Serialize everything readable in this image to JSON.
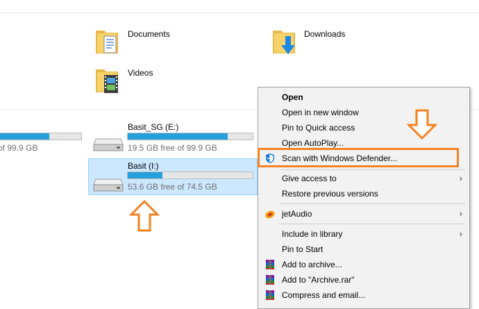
{
  "folders": [
    {
      "name": "Documents"
    },
    {
      "name": "Downloads"
    },
    {
      "name": "Videos"
    }
  ],
  "drives": [
    {
      "name": "",
      "free_text": "of 99.9 GB",
      "used_fraction": 0.62
    },
    {
      "name": "Basit_SG (E:)",
      "free_text": "19.5 GB free of 99.9 GB",
      "used_fraction": 0.8
    },
    {
      "name": "Basit (I:)",
      "free_text": "53.6 GB free of 74.5 GB",
      "used_fraction": 0.28,
      "selected": true
    }
  ],
  "context_menu": {
    "items": [
      {
        "label": "Open",
        "bold": true
      },
      {
        "label": "Open in new window"
      },
      {
        "label": "Pin to Quick access"
      },
      {
        "label": "Open AutoPlay..."
      },
      {
        "label": "Scan with Windows Defender...",
        "icon": "windows-defender-icon",
        "highlighted": true
      },
      {
        "label": "Give access to",
        "submenu": true
      },
      {
        "label": "Restore previous versions"
      },
      {
        "label": "jetAudio",
        "icon": "jetaudio-icon",
        "submenu": true
      },
      {
        "label": "Include in library",
        "submenu": true
      },
      {
        "label": "Pin to Start"
      },
      {
        "label": "Add to archive...",
        "icon": "winrar-icon"
      },
      {
        "label": "Add to \"Archive.rar\"",
        "icon": "winrar-icon"
      },
      {
        "label": "Compress and email...",
        "icon": "winrar-icon"
      }
    ],
    "submenu_arrow": "›"
  },
  "colors": {
    "accent_bar": "#26a0da",
    "highlight_box": "#f58220",
    "selection": "#cce8ff"
  }
}
